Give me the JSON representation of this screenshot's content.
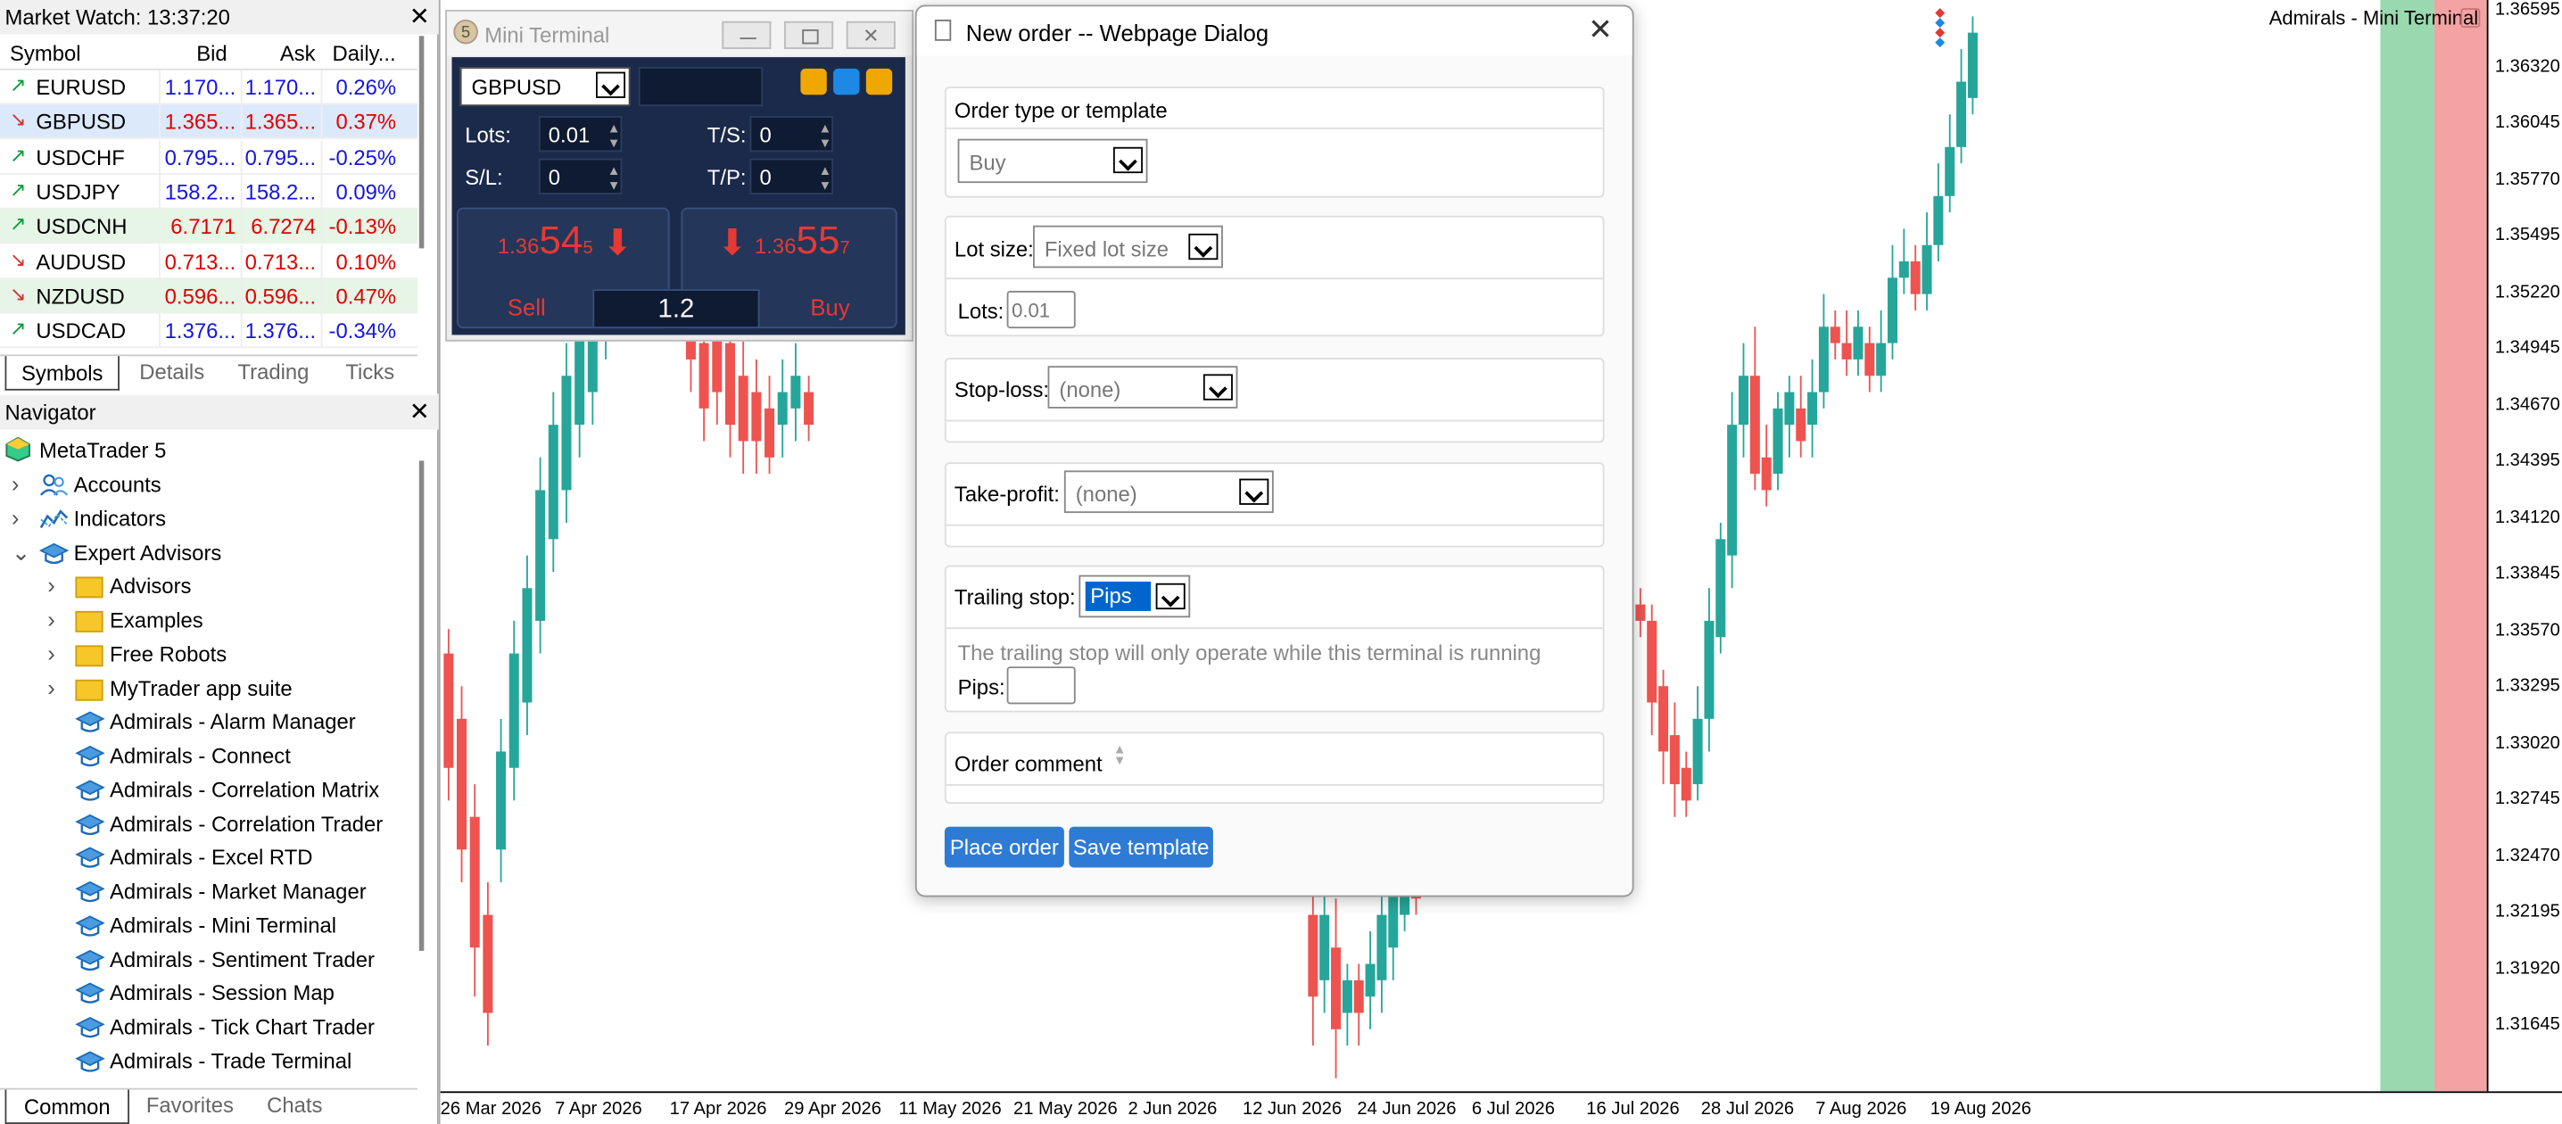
{
  "market_watch": {
    "title": "Market Watch: 13:37:20",
    "columns": [
      "Symbol",
      "Bid",
      "Ask",
      "Daily..."
    ],
    "rows": [
      {
        "symbol": "EURUSD",
        "dir": "up",
        "bid": "1.170...",
        "ask": "1.170...",
        "daily": "0.26%",
        "color": "blue"
      },
      {
        "symbol": "GBPUSD",
        "dir": "down",
        "bid": "1.365...",
        "ask": "1.365...",
        "daily": "0.37%",
        "color": "red"
      },
      {
        "symbol": "USDCHF",
        "dir": "up",
        "bid": "0.795...",
        "ask": "0.795...",
        "daily": "-0.25%",
        "color": "blue"
      },
      {
        "symbol": "USDJPY",
        "dir": "up",
        "bid": "158.2...",
        "ask": "158.2...",
        "daily": "0.09%",
        "color": "blue"
      },
      {
        "symbol": "USDCNH",
        "dir": "up",
        "bid": "6.7171",
        "ask": "6.7274",
        "daily": "-0.13%",
        "color": "red"
      },
      {
        "symbol": "AUDUSD",
        "dir": "down",
        "bid": "0.713...",
        "ask": "0.713...",
        "daily": "0.10%",
        "color": "red"
      },
      {
        "symbol": "NZDUSD",
        "dir": "down",
        "bid": "0.596...",
        "ask": "0.596...",
        "daily": "0.47%",
        "color": "red"
      },
      {
        "symbol": "USDCAD",
        "dir": "up",
        "bid": "1.376...",
        "ask": "1.376...",
        "daily": "-0.34%",
        "color": "blue"
      }
    ],
    "tabs": [
      "Symbols",
      "Details",
      "Trading",
      "Ticks"
    ]
  },
  "navigator": {
    "title": "Navigator",
    "root": "MetaTrader 5",
    "items": [
      {
        "label": "Accounts",
        "level": 1,
        "icon": "accounts-icon",
        "expander": "›"
      },
      {
        "label": "Indicators",
        "level": 1,
        "icon": "indicators-icon",
        "expander": "›"
      },
      {
        "label": "Expert Advisors",
        "level": 1,
        "icon": "expert-icon",
        "expander": "⌄"
      },
      {
        "label": "Advisors",
        "level": 2,
        "icon": "folder-icon",
        "expander": "›"
      },
      {
        "label": "Examples",
        "level": 2,
        "icon": "folder-icon",
        "expander": "›"
      },
      {
        "label": "Free Robots",
        "level": 2,
        "icon": "folder-icon",
        "expander": "›"
      },
      {
        "label": "MyTrader app suite",
        "level": 2,
        "icon": "folder-icon",
        "expander": "›"
      },
      {
        "label": "Admirals - Alarm Manager",
        "level": 2,
        "icon": "expert-icon",
        "expander": ""
      },
      {
        "label": "Admirals - Connect",
        "level": 2,
        "icon": "expert-icon",
        "expander": ""
      },
      {
        "label": "Admirals - Correlation Matrix",
        "level": 2,
        "icon": "expert-icon",
        "expander": ""
      },
      {
        "label": "Admirals - Correlation Trader",
        "level": 2,
        "icon": "expert-icon",
        "expander": ""
      },
      {
        "label": "Admirals - Excel RTD",
        "level": 2,
        "icon": "expert-icon",
        "expander": ""
      },
      {
        "label": "Admirals - Market Manager",
        "level": 2,
        "icon": "expert-icon",
        "expander": ""
      },
      {
        "label": "Admirals - Mini Terminal",
        "level": 2,
        "icon": "expert-icon",
        "expander": ""
      },
      {
        "label": "Admirals - Sentiment Trader",
        "level": 2,
        "icon": "expert-icon",
        "expander": ""
      },
      {
        "label": "Admirals - Session Map",
        "level": 2,
        "icon": "expert-icon",
        "expander": ""
      },
      {
        "label": "Admirals - Tick Chart Trader",
        "level": 2,
        "icon": "expert-icon",
        "expander": ""
      },
      {
        "label": "Admirals - Trade Terminal",
        "level": 2,
        "icon": "expert-icon",
        "expander": ""
      }
    ],
    "tabs": [
      "Common",
      "Favorites",
      "Chats"
    ]
  },
  "mini_terminal": {
    "title": "Mini Terminal",
    "symbol": "GBPUSD",
    "lots_label": "Lots:",
    "lots_value": "0.01",
    "ts_label": "T/S:",
    "ts_value": "0",
    "sl_label": "S/L:",
    "sl_value": "0",
    "tp_label": "T/P:",
    "tp_value": "0",
    "sell_small": "1.36",
    "sell_big": "54",
    "sell_sup": "5",
    "buy_small": "1.36",
    "buy_big": "55",
    "buy_sup": "7",
    "sell_label": "Sell",
    "buy_label": "Buy",
    "spread": "1.2"
  },
  "dialog": {
    "title": "New order -- Webpage Dialog",
    "order_type_label": "Order type or template",
    "order_type_value": "Buy",
    "lot_size_label": "Lot size:",
    "lot_size_value": "Fixed lot size",
    "lots_label": "Lots:",
    "lots_placeholder": "0.01",
    "stoploss_label": "Stop-loss:",
    "stoploss_value": "(none)",
    "takeprofit_label": "Take-profit:",
    "takeprofit_value": "(none)",
    "trailing_label": "Trailing stop:",
    "trailing_value": "Pips",
    "trailing_note": "The trailing stop will only operate while this terminal is running",
    "pips_label": "Pips:",
    "comment_label": "Order comment",
    "place_order": "Place order",
    "save_template": "Save template"
  },
  "chart": {
    "label": "Admirals - Mini Terminal",
    "price_axis": [
      "1.36595",
      "1.36320",
      "1.36045",
      "1.35770",
      "1.35495",
      "1.35220",
      "1.34945",
      "1.34670",
      "1.34395",
      "1.34120",
      "1.33845",
      "1.33570",
      "1.33295",
      "1.33020",
      "1.32745",
      "1.32470",
      "1.32195",
      "1.31920",
      "1.31645"
    ],
    "date_axis": [
      "26 Mar 2026",
      "7 Apr 2026",
      "17 Apr 2026",
      "29 Apr 2026",
      "11 May 2026",
      "21 May 2026",
      "2 Jun 2026",
      "12 Jun 2026",
      "24 Jun 2026",
      "6 Jul 2026",
      "16 Jul 2026",
      "28 Jul 2026",
      "7 Aug 2026",
      "19 Aug 2026"
    ],
    "colors": {
      "bull": "#26a69a",
      "bear": "#ef5350",
      "session_green": "#9ad8b0",
      "session_red": "#f3a3a3"
    }
  }
}
